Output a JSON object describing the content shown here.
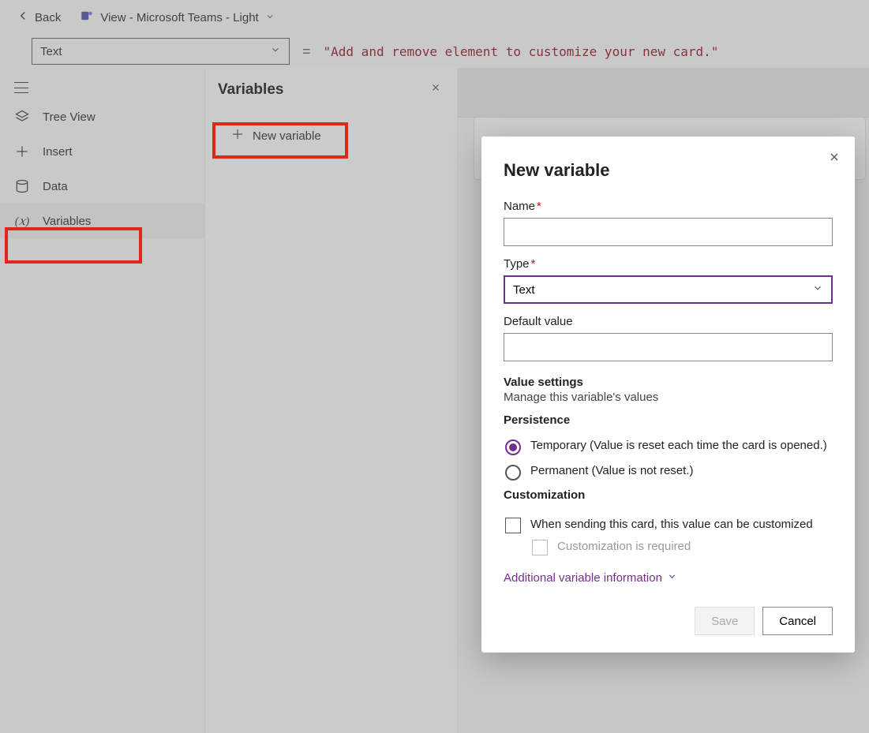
{
  "topbar": {
    "back": "Back",
    "title": "View - Microsoft Teams - Light"
  },
  "formula": {
    "property": "Text",
    "expr": "\"Add and remove element to customize your new card.\""
  },
  "rail": {
    "tree": "Tree View",
    "insert": "Insert",
    "data": "Data",
    "variables": "Variables"
  },
  "panel": {
    "title": "Variables",
    "new_variable": "New variable"
  },
  "dialog": {
    "title": "New variable",
    "name_label": "Name",
    "type_label": "Type",
    "type_value": "Text",
    "default_label": "Default value",
    "vs_heading": "Value settings",
    "vs_sub": "Manage this variable's values",
    "pers_heading": "Persistence",
    "pers_temp": "Temporary (Value is reset each time the card is opened.)",
    "pers_perm": "Permanent (Value is not reset.)",
    "cust_heading": "Customization",
    "cust_cb": "When sending this card, this value can be customized",
    "cust_req": "Customization is required",
    "more_link": "Additional variable information",
    "save": "Save",
    "cancel": "Cancel"
  }
}
